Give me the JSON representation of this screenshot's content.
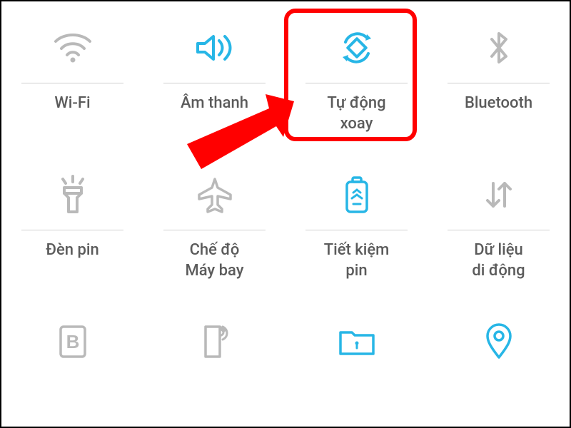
{
  "colors": {
    "active": "#27b6e6",
    "inactive": "#b9b9b9",
    "highlight": "#ff0000"
  },
  "tiles": [
    {
      "id": "wifi",
      "label": "Wi-Fi",
      "active": false
    },
    {
      "id": "sound",
      "label": "Âm thanh",
      "active": true
    },
    {
      "id": "autorotate",
      "label": "Tự động\nxoay",
      "active": true
    },
    {
      "id": "bluetooth",
      "label": "Bluetooth",
      "active": false
    },
    {
      "id": "flashlight",
      "label": "Đèn pin",
      "active": false
    },
    {
      "id": "airplane",
      "label": "Chế độ\nMáy bay",
      "active": false
    },
    {
      "id": "battery",
      "label": "Tiết kiệm\npin",
      "active": true
    },
    {
      "id": "mobiledata",
      "label": "Dữ liệu\ndi động",
      "active": false
    },
    {
      "id": "bold",
      "label": "",
      "active": false
    },
    {
      "id": "hotspot",
      "label": "",
      "active": false
    },
    {
      "id": "folder",
      "label": "",
      "active": true
    },
    {
      "id": "location",
      "label": "",
      "active": true
    }
  ],
  "highlighted_tile": "autorotate"
}
